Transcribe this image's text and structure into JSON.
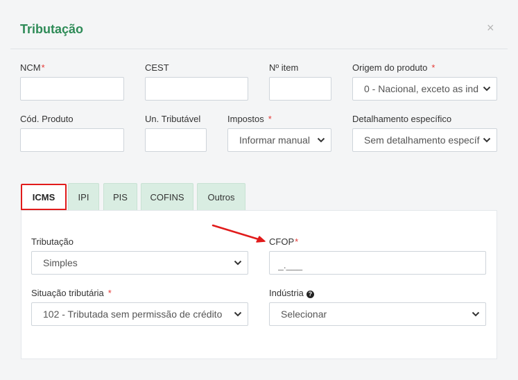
{
  "modal": {
    "title": "Tributação",
    "close": "×"
  },
  "fields": {
    "ncm": {
      "label": "NCM",
      "required": "*",
      "value": ""
    },
    "cest": {
      "label": "CEST",
      "value": ""
    },
    "item": {
      "label": "Nº item",
      "value": ""
    },
    "origem": {
      "label": "Origem do produto",
      "required": "*",
      "value": "0 - Nacional, exceto as ind"
    },
    "cod_produto": {
      "label": "Cód. Produto",
      "value": ""
    },
    "un_tributavel": {
      "label": "Un. Tributável",
      "value": ""
    },
    "impostos": {
      "label": "Impostos",
      "required": "*",
      "value": "Informar manual"
    },
    "detalhamento": {
      "label": "Detalhamento específico",
      "value": "Sem detalhamento específ"
    }
  },
  "tabs": [
    {
      "label": "ICMS",
      "active": true
    },
    {
      "label": "IPI"
    },
    {
      "label": "PIS"
    },
    {
      "label": "COFINS"
    },
    {
      "label": "Outros"
    }
  ],
  "icms": {
    "tributacao": {
      "label": "Tributação",
      "value": "Simples"
    },
    "cfop": {
      "label": "CFOP",
      "required": "*",
      "placeholder": "_.___"
    },
    "situacao": {
      "label": "Situação tributária",
      "required": "*",
      "value": "102 - Tributada sem permissão de crédito"
    },
    "industria": {
      "label": "Indústria",
      "value": "Selecionar"
    }
  },
  "colors": {
    "title": "#2e8b57",
    "tab_bg": "#d9ede2",
    "active_tab_border": "#e11b1b",
    "required": "#e53935",
    "arrow": "#e11b1b"
  }
}
